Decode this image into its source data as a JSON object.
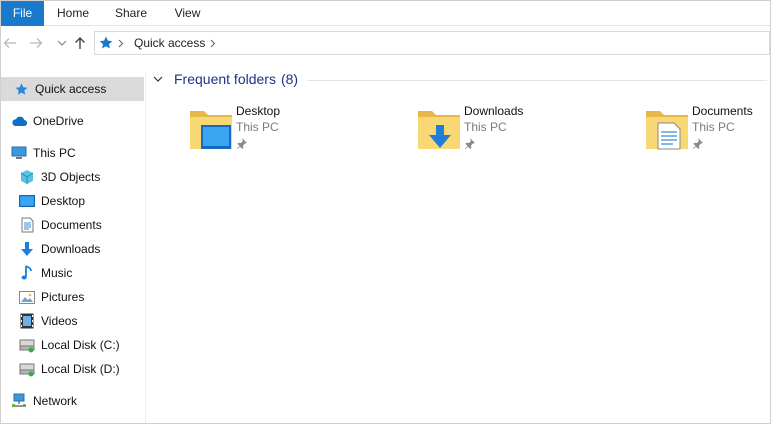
{
  "ribbon": {
    "tabs": [
      {
        "label": "File"
      },
      {
        "label": "Home"
      },
      {
        "label": "Share"
      },
      {
        "label": "View"
      }
    ]
  },
  "address": {
    "icon": "quick-access-star-icon",
    "crumb": "Quick access"
  },
  "navpane": {
    "items": [
      {
        "label": "Quick access",
        "icon": "star-icon",
        "selected": true
      },
      {
        "label": "OneDrive",
        "icon": "cloud-icon"
      },
      {
        "label": "This PC",
        "icon": "computer-icon"
      },
      {
        "label": "3D Objects",
        "icon": "cube-icon"
      },
      {
        "label": "Desktop",
        "icon": "desktop-icon"
      },
      {
        "label": "Documents",
        "icon": "document-icon"
      },
      {
        "label": "Downloads",
        "icon": "download-arrow-icon"
      },
      {
        "label": "Music",
        "icon": "music-note-icon"
      },
      {
        "label": "Pictures",
        "icon": "picture-icon"
      },
      {
        "label": "Videos",
        "icon": "film-icon"
      },
      {
        "label": "Local Disk (C:)",
        "icon": "drive-icon"
      },
      {
        "label": "Local Disk (D:)",
        "icon": "drive-icon"
      },
      {
        "label": "Network",
        "icon": "network-icon"
      }
    ]
  },
  "content": {
    "group_title": "Frequent folders",
    "group_count": "(8)",
    "folders": [
      {
        "name": "Desktop",
        "location": "This PC",
        "icon": "desktop-folder-icon"
      },
      {
        "name": "Downloads",
        "location": "This PC",
        "icon": "downloads-folder-icon"
      },
      {
        "name": "Documents",
        "location": "This PC",
        "icon": "documents-folder-icon"
      }
    ]
  },
  "colors": {
    "accent": "#1979ca",
    "group_header": "#1e3287",
    "selected_bg": "#dadada",
    "folder_yellow": "#f8d775"
  }
}
